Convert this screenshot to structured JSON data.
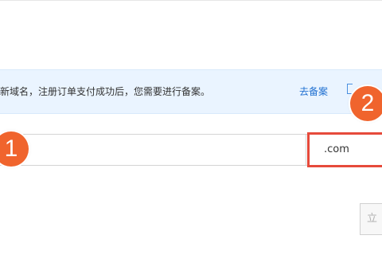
{
  "notice": {
    "text": "新域名，注册订单支付成功后，您需要进行备案。",
    "link_label": "去备案",
    "link_icon": "external-link-icon"
  },
  "domain_form": {
    "input_value": "",
    "suffix_value": ".com"
  },
  "annotations": {
    "badge_1": "1",
    "badge_2": "2",
    "badge_color": "#f0642d",
    "highlight_color": "#e64a3b"
  },
  "actions": {
    "next_label": "立"
  }
}
